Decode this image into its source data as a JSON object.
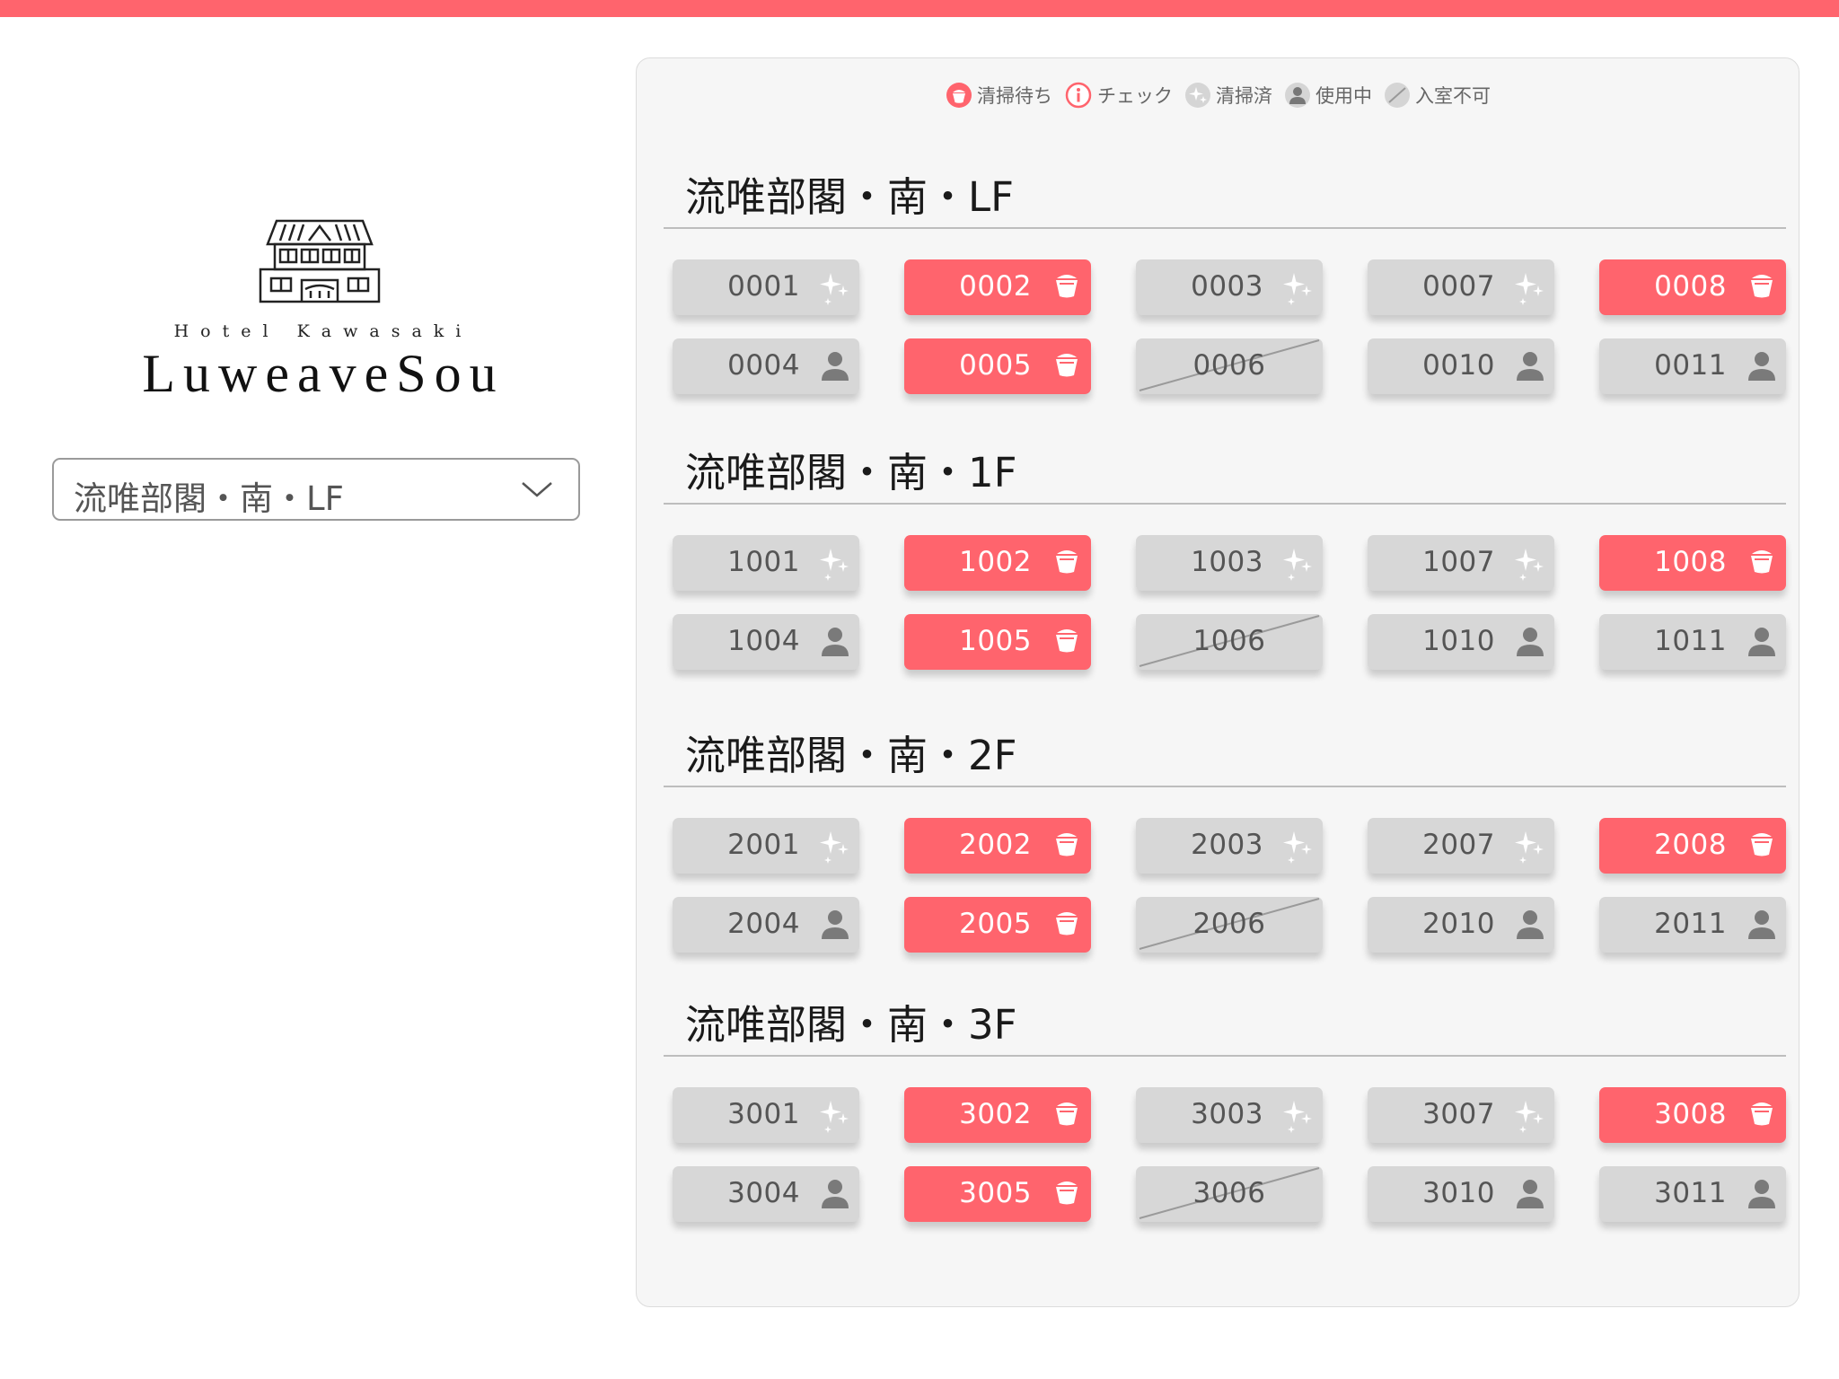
{
  "brand": {
    "subtitle": "Hotel Kawasaki",
    "name": "LuweaveSou"
  },
  "floor_select": {
    "value": "流唯部閣・南・LF"
  },
  "legend": [
    {
      "label": "清掃待ち",
      "icon": "bucket-icon"
    },
    {
      "label": "チェック",
      "icon": "info-icon"
    },
    {
      "label": "清掃済",
      "icon": "sparkle-icon"
    },
    {
      "label": "使用中",
      "icon": "person-icon"
    },
    {
      "label": "入室不可",
      "icon": "blocked-icon"
    }
  ],
  "colors": {
    "accent": "#ff646d",
    "room_default": "#d7d7d7",
    "panel": "#f6f6f6"
  },
  "floors": [
    {
      "title": "流唯部閣・南・LF",
      "rooms": [
        {
          "number": "0001",
          "status": "cleaned"
        },
        {
          "number": "0002",
          "status": "waiting"
        },
        {
          "number": "0003",
          "status": "cleaned"
        },
        {
          "number": "0007",
          "status": "cleaned"
        },
        {
          "number": "0008",
          "status": "waiting"
        },
        {
          "number": "0004",
          "status": "occupied"
        },
        {
          "number": "0005",
          "status": "waiting"
        },
        {
          "number": "0006",
          "status": "blocked"
        },
        {
          "number": "0010",
          "status": "occupied"
        },
        {
          "number": "0011",
          "status": "occupied"
        }
      ]
    },
    {
      "title": "流唯部閣・南・1F",
      "rooms": [
        {
          "number": "1001",
          "status": "cleaned"
        },
        {
          "number": "1002",
          "status": "waiting"
        },
        {
          "number": "1003",
          "status": "cleaned"
        },
        {
          "number": "1007",
          "status": "cleaned"
        },
        {
          "number": "1008",
          "status": "waiting"
        },
        {
          "number": "1004",
          "status": "occupied"
        },
        {
          "number": "1005",
          "status": "waiting"
        },
        {
          "number": "1006",
          "status": "blocked"
        },
        {
          "number": "1010",
          "status": "occupied"
        },
        {
          "number": "1011",
          "status": "occupied"
        }
      ]
    },
    {
      "title": "流唯部閣・南・2F",
      "rooms": [
        {
          "number": "2001",
          "status": "cleaned"
        },
        {
          "number": "2002",
          "status": "waiting"
        },
        {
          "number": "2003",
          "status": "cleaned"
        },
        {
          "number": "2007",
          "status": "cleaned"
        },
        {
          "number": "2008",
          "status": "waiting"
        },
        {
          "number": "2004",
          "status": "occupied"
        },
        {
          "number": "2005",
          "status": "waiting"
        },
        {
          "number": "2006",
          "status": "blocked"
        },
        {
          "number": "2010",
          "status": "occupied"
        },
        {
          "number": "2011",
          "status": "occupied"
        }
      ]
    },
    {
      "title": "流唯部閣・南・3F",
      "rooms": [
        {
          "number": "3001",
          "status": "cleaned"
        },
        {
          "number": "3002",
          "status": "waiting"
        },
        {
          "number": "3003",
          "status": "cleaned"
        },
        {
          "number": "3007",
          "status": "cleaned"
        },
        {
          "number": "3008",
          "status": "waiting"
        },
        {
          "number": "3004",
          "status": "occupied"
        },
        {
          "number": "3005",
          "status": "waiting"
        },
        {
          "number": "3006",
          "status": "blocked"
        },
        {
          "number": "3010",
          "status": "occupied"
        },
        {
          "number": "3011",
          "status": "occupied"
        }
      ]
    }
  ]
}
